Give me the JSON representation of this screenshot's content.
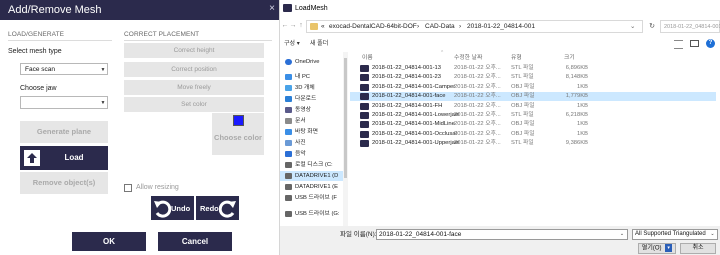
{
  "mesh_dialog": {
    "title": "Add/Remove Mesh",
    "close_glyph": "×",
    "load_generate": {
      "heading": "LOAD/GENERATE",
      "mesh_type_label": "Select mesh type",
      "mesh_type_value": "Face scan",
      "jaw_label": "Choose jaw",
      "jaw_value": "",
      "generate_label": "Generate plane",
      "load_label": "Load",
      "remove_label": "Remove object(s)"
    },
    "correct_placement": {
      "heading": "CORRECT PLACEMENT",
      "buttons": [
        "Correct height",
        "Correct position",
        "Move freely",
        "Set color"
      ],
      "choose_color_label": "Choose color",
      "swatch_color": "#1a1aff",
      "allow_resizing_label": "Allow resizing",
      "allow_resizing_checked": false,
      "undo_label": "Undo",
      "redo_label": "Redo"
    },
    "ok_label": "OK",
    "cancel_label": "Cancel",
    "colors": {
      "accent": "#2b2a4c",
      "disabled_bg": "#e6e6e6",
      "disabled_text": "#9a9a9a"
    }
  },
  "file_dialog": {
    "title": "LoadMesh",
    "nav_back": "←",
    "nav_forward": "→",
    "nav_up": "↑",
    "address_chevron": "«",
    "breadcrumbs": [
      "exocad-DentalCAD-64bit-DOF",
      "CAD-Data",
      "2018-01-22_04814-001"
    ],
    "crumb_sep": "›",
    "search_placeholder": "2018-01-22_04814-001 검색",
    "commands": {
      "organize": "구성 ▾",
      "new_folder": "새 폴더"
    },
    "nav_items": [
      {
        "label": "OneDrive",
        "icon": "cloud-icon",
        "color": "#2b6fd6"
      },
      {
        "label": "내 PC",
        "icon": "pc-icon",
        "color": "#3a8ee6"
      },
      {
        "label": "3D 개체",
        "icon": "cube-icon",
        "color": "#4aa3e8"
      },
      {
        "label": "다운로드",
        "icon": "download-icon",
        "color": "#2b7fd6"
      },
      {
        "label": "동영상",
        "icon": "video-icon",
        "color": "#5a5a8a"
      },
      {
        "label": "문서",
        "icon": "document-icon",
        "color": "#8a8a8a"
      },
      {
        "label": "바탕 화면",
        "icon": "desktop-icon",
        "color": "#3a8ee6"
      },
      {
        "label": "사진",
        "icon": "picture-icon",
        "color": "#6a9ad6"
      },
      {
        "label": "음악",
        "icon": "music-icon",
        "color": "#2b6fd6"
      },
      {
        "label": "로컬 디스크 (C:",
        "icon": "drive-icon",
        "color": "#666666"
      },
      {
        "label": "DATADRIVE1 (D",
        "icon": "drive-icon",
        "color": "#666666",
        "selected": true
      },
      {
        "label": "DATADRIVE1 (E",
        "icon": "drive-icon",
        "color": "#666666"
      },
      {
        "label": "USB 드라이브 (F",
        "icon": "usb-icon",
        "color": "#666666"
      },
      {
        "label": "USB 드라이브 (G:",
        "icon": "usb-icon",
        "color": "#666666"
      }
    ],
    "columns": {
      "name": "이름",
      "date": "수정한 날짜",
      "type": "유형",
      "size": "크기"
    },
    "files": [
      {
        "name": "2018-01-22_04814-001-13",
        "date": "2018-01-22 오후...",
        "type": "STL 파일",
        "size": "6,896KB"
      },
      {
        "name": "2018-01-22_04814-001-23",
        "date": "2018-01-22 오후...",
        "type": "STL 파일",
        "size": "8,148KB"
      },
      {
        "name": "2018-01-22_04814-001-Camper",
        "date": "2018-01-22 오후...",
        "type": "OBJ 파일",
        "size": "1KB"
      },
      {
        "name": "2018-01-22_04814-001-face",
        "date": "2018-01-22 오후...",
        "type": "OBJ 파일",
        "size": "1,779KB",
        "selected": true
      },
      {
        "name": "2018-01-22_04814-001-FH",
        "date": "2018-01-22 오후...",
        "type": "OBJ 파일",
        "size": "1KB"
      },
      {
        "name": "2018-01-22_04814-001-Lowerjaw",
        "date": "2018-01-22 오후...",
        "type": "STL 파일",
        "size": "6,218KB"
      },
      {
        "name": "2018-01-22_04814-001-MidLine",
        "date": "2018-01-22 오후...",
        "type": "OBJ 파일",
        "size": "1KB"
      },
      {
        "name": "2018-01-22_04814-001-Occlusal",
        "date": "2018-01-22 오후...",
        "type": "OBJ 파일",
        "size": "1KB"
      },
      {
        "name": "2018-01-22_04814-001-Upperjaw",
        "date": "2018-01-22 오후...",
        "type": "STL 파일",
        "size": "9,386KB"
      }
    ],
    "file_name_label": "파일 이름(N):",
    "file_name_value": "2018-01-22_04814-001-face",
    "file_type_value": "All Supported Triangulated",
    "open_label": "열기(O)",
    "cancel_label": "취소"
  }
}
